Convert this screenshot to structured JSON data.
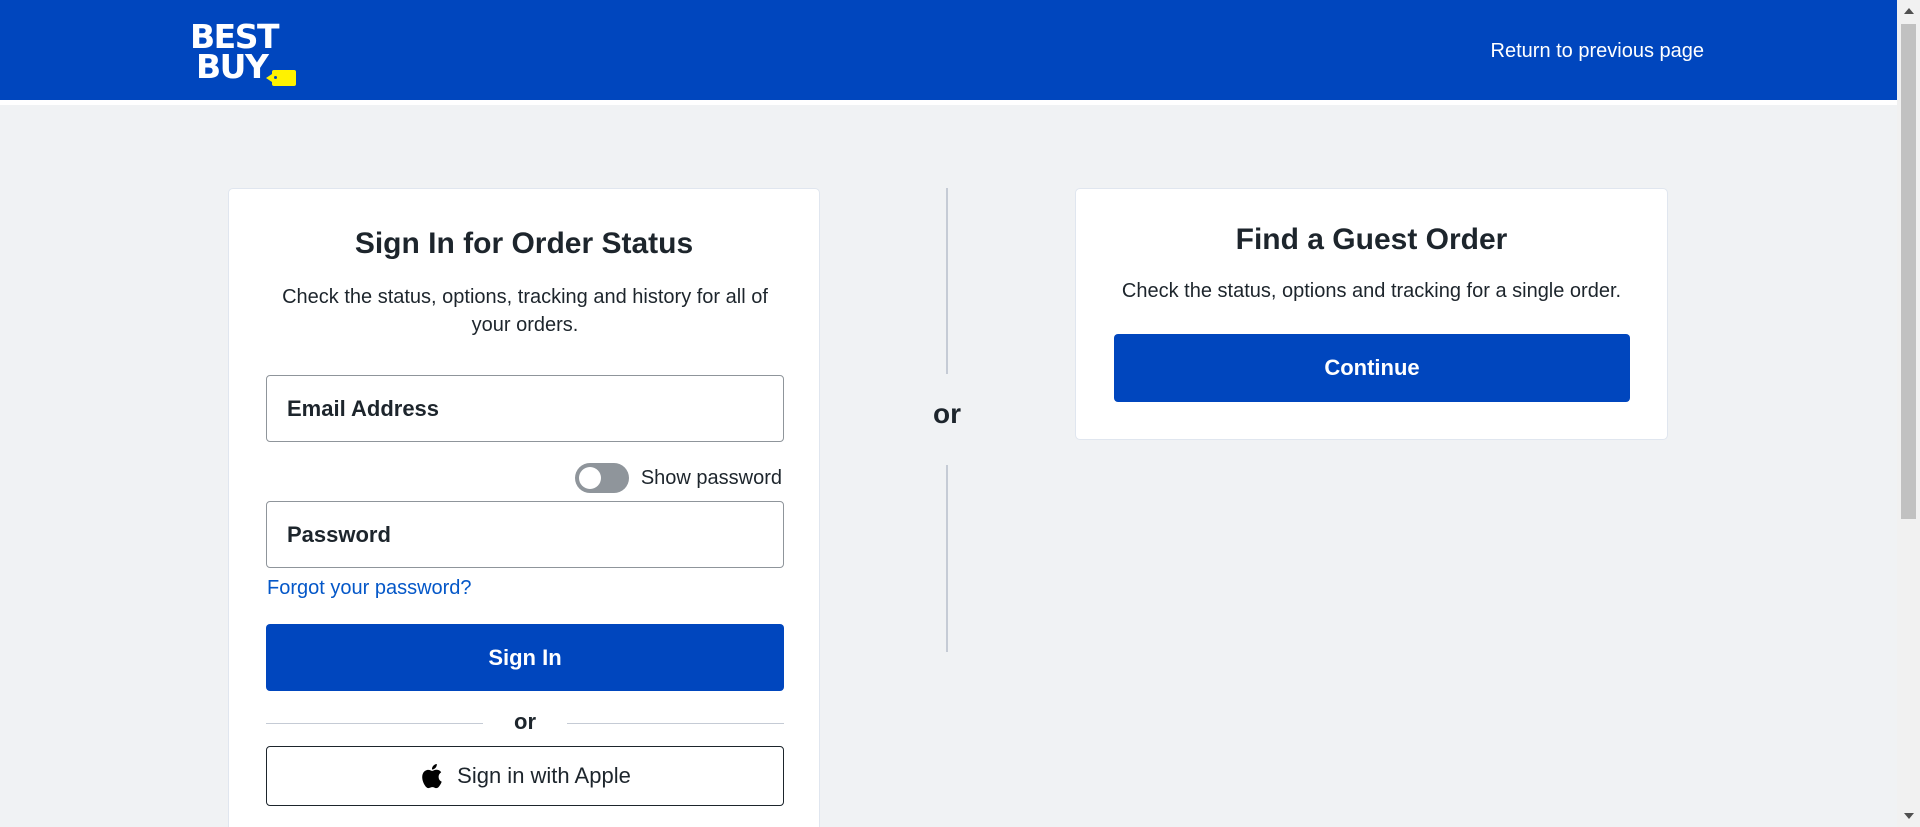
{
  "header": {
    "logo_line1": "BEST",
    "logo_line2": "BUY",
    "return_link": "Return to previous page"
  },
  "signin": {
    "title": "Sign In for Order Status",
    "description": "Check the status, options, tracking and history for all of your orders.",
    "email_placeholder": "Email Address",
    "show_password_label": "Show password",
    "password_placeholder": "Password",
    "forgot_link": "Forgot your password?",
    "signin_button": "Sign In",
    "or_text": "or",
    "apple_button": "Sign in with Apple"
  },
  "divider": {
    "or_text": "or"
  },
  "guest": {
    "title": "Find a Guest Order",
    "description": "Check the status, options and tracking for a single order.",
    "continue_button": "Continue"
  },
  "colors": {
    "brand_blue": "#0046be",
    "brand_yellow": "#fff200",
    "link_blue": "#0457c8",
    "background": "#f0f2f4"
  },
  "icons": {
    "apple": "apple-logo-icon",
    "logo_tag": "price-tag-icon"
  }
}
